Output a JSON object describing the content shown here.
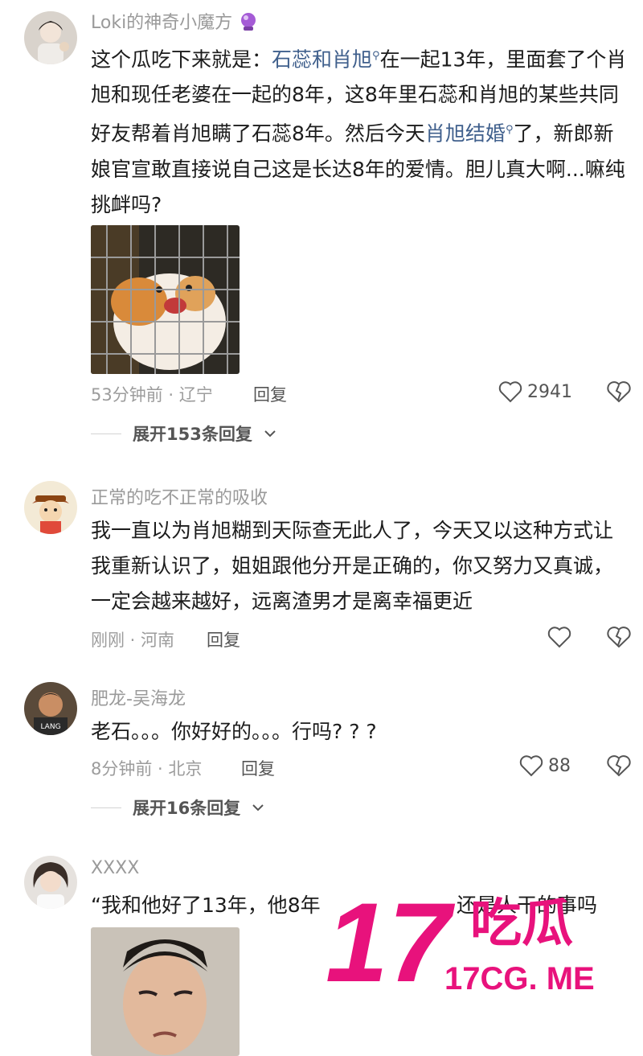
{
  "comments": [
    {
      "username": "Loki的神奇小魔方",
      "text_parts": [
        "这个瓜吃下来就是：",
        "石蕊和肖旭",
        "在一起13年，里面套了个肖旭和现任老婆在一起的8年，这8年里石蕊和肖旭的某些共同好友帮着肖旭瞒了石蕊8年。然后今天",
        "肖旭结婚",
        "了，新郎新娘官宣敢直接说自己这是长达8年的爱情。胆儿真大啊...嘛纯挑衅吗?"
      ],
      "time_location": "53分钟前 · 辽宁",
      "reply_label": "回复",
      "likes": "2941",
      "expand_label": "展开153条回复"
    },
    {
      "username": "正常的吃不正常的吸收",
      "text": "我一直以为肖旭糊到天际查无此人了，今天又以这种方式让我重新认识了，姐姐跟他分开是正确的，你又努力又真诚，一定会越来越好，远离渣男才是离幸福更近",
      "time_location": "刚刚 · 河南",
      "reply_label": "回复"
    },
    {
      "username": "肥龙-吴海龙",
      "text": "老石。。。你好好的。。。行吗? ? ?",
      "time_location": "8分钟前 · 北京",
      "reply_label": "回复",
      "likes": "88",
      "expand_label": "展开16条回复"
    },
    {
      "username": "XXXX",
      "text": "“我和他好了13年，他8年",
      "text_tail": "还是人干的事吗"
    }
  ],
  "avatar3_text": "LANG",
  "watermark": {
    "big": "17",
    "cn": "吃瓜",
    "url": "17CG. ME",
    "color": "#e8127c"
  },
  "colors": {
    "link": "#3f5f8c",
    "meta": "#9c9c9c"
  }
}
